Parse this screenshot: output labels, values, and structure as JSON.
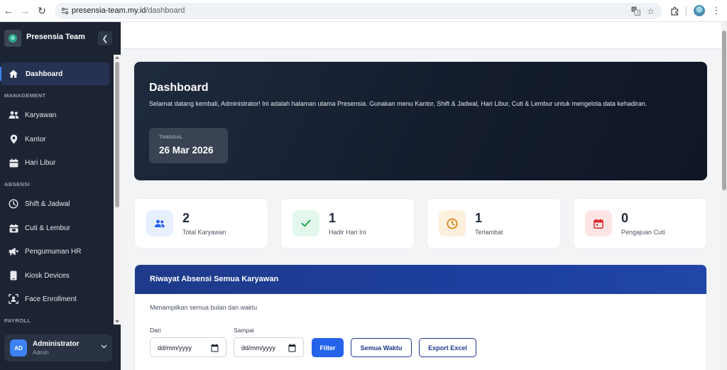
{
  "browser": {
    "url_host": "presensia-team.my.id",
    "url_path": "/dashboard"
  },
  "sidebar": {
    "brand": "Presensia Team",
    "items": {
      "dashboard": "Dashboard",
      "karyawan": "Karyawan",
      "kantor": "Kantor",
      "hari_libur": "Hari Libur",
      "shift_jadwal": "Shift & Jadwal",
      "cuti_lembur": "Cuti & Lembur",
      "pengumuman": "Pengumuman HR",
      "kiosk": "Kiosk Devices",
      "face": "Face Enrollment"
    },
    "sections": {
      "management": "MANAGEMENT",
      "absensi": "ABSENSI",
      "payroll": "PAYROLL"
    },
    "user": {
      "initials": "AD",
      "name": "Administrator",
      "role": "Admin"
    }
  },
  "hero": {
    "title": "Dashboard",
    "description": "Selamat datang kembali, Administrator! Ini adalah halaman utama Presensia. Gunakan menu Kantor, Shift & Jadwal, Hari Libur, Cuti & Lembur untuk mengelola data kehadiran.",
    "date_label": "TANGGAL",
    "date_value": "26 Mar 2026"
  },
  "stats": [
    {
      "value": "2",
      "label": "Total Karyawan",
      "icon": "users-icon",
      "color": "#2563eb",
      "bg": "#e8efff"
    },
    {
      "value": "1",
      "label": "Hadir Hari Ini",
      "icon": "check-icon",
      "color": "#16a34a",
      "bg": "#e3f7ec"
    },
    {
      "value": "1",
      "label": "Terlambat",
      "icon": "clock-icon",
      "color": "#d97706",
      "bg": "#fdf0dc"
    },
    {
      "value": "0",
      "label": "Pengajuan Cuti",
      "icon": "calendar-icon",
      "color": "#dc2626",
      "bg": "#fde4e4"
    }
  ],
  "attendance": {
    "title": "Riwayat Absensi Semua Karyawan",
    "subtitle": "Menampilkan semua bulan dan waktu",
    "from_label": "Dari",
    "to_label": "Sampai",
    "date_placeholder": "dd/mm/yyyy",
    "filter_button": "Filter",
    "all_time_button": "Semua Waktu",
    "export_button": "Export Excel"
  },
  "colors": {
    "sidebar_bg": "#1c2433",
    "accent": "#2563eb",
    "header_blue": "#1e3a8a"
  }
}
